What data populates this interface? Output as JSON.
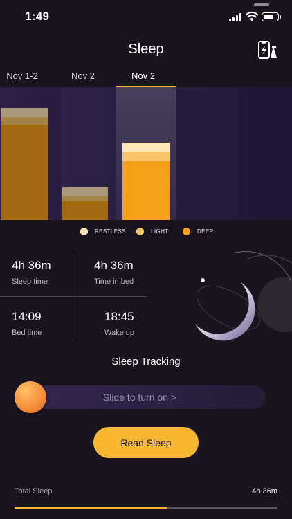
{
  "status_bar": {
    "time": "1:49"
  },
  "header": {
    "title": "Sleep",
    "device_icon": "phone-lightning-icon"
  },
  "tabs": [
    {
      "label": "Nov 1-2",
      "selected": false
    },
    {
      "label": "Nov 2",
      "selected": false
    },
    {
      "label": "Nov 2",
      "selected": true
    }
  ],
  "chart_data": {
    "type": "bar",
    "stacked": true,
    "categories": [
      "Nov 1-2",
      "Nov 2",
      "Nov 2"
    ],
    "series": [
      {
        "name": "RESTLESS",
        "color": "#fde8b8",
        "values": [
          0.4,
          0.4,
          0.4
        ]
      },
      {
        "name": "LIGHT",
        "color": "#f8c56a",
        "values": [
          0.35,
          0.25,
          0.45
        ]
      },
      {
        "name": "DEEP",
        "color": "#f7a11a",
        "values": [
          4.3,
          0.85,
          2.65
        ]
      }
    ],
    "selected_index": 2,
    "ylim": [
      0,
      6
    ]
  },
  "legend": [
    {
      "label": "RESTLESS",
      "color": "#fde8b8"
    },
    {
      "label": "LIGHT",
      "color": "#f8c56a"
    },
    {
      "label": "DEEP",
      "color": "#f7a11a"
    }
  ],
  "stats": {
    "sleep_time": {
      "value": "4h 36m",
      "label": "Sleep time"
    },
    "time_in_bed": {
      "value": "4h 36m",
      "label": "Time in bed"
    },
    "bed_time": {
      "value": "14:09",
      "label": "Bed time"
    },
    "wake_up": {
      "value": "18:45",
      "label": "Wake up"
    }
  },
  "tracking": {
    "title": "Sleep Tracking",
    "slider_text": "Slide to turn on >",
    "enabled": false
  },
  "read_button": {
    "label": "Read Sleep"
  },
  "total": {
    "label": "Total Sleep",
    "value": "4h 36m",
    "progress": 0.58
  },
  "colors": {
    "accent": "#f7b733",
    "background": "#19141d"
  }
}
